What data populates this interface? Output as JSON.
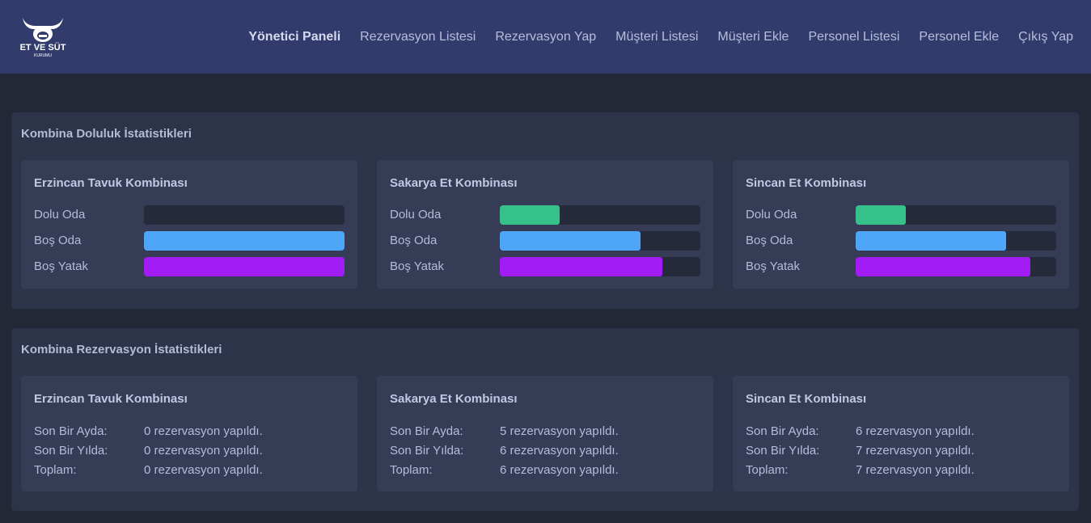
{
  "logo": {
    "text": "ET VE SÜT",
    "subtext": "KURUMU"
  },
  "nav": {
    "items": [
      {
        "label": "Yönetici Paneli",
        "active": true
      },
      {
        "label": "Rezervasyon Listesi",
        "active": false
      },
      {
        "label": "Rezervasyon Yap",
        "active": false
      },
      {
        "label": "Müşteri Listesi",
        "active": false
      },
      {
        "label": "Müşteri Ekle",
        "active": false
      },
      {
        "label": "Personel Listesi",
        "active": false
      },
      {
        "label": "Personel Ekle",
        "active": false
      },
      {
        "label": "Çıkış Yap",
        "active": false
      }
    ]
  },
  "colors": {
    "dolu_oda": "#36c08a",
    "bos_oda": "#4fa6f8",
    "bos_yatak": "#a11cf5"
  },
  "occupancy": {
    "title": "Kombina Doluluk İstatistikleri",
    "labels": {
      "dolu_oda": "Dolu Oda",
      "bos_oda": "Boş Oda",
      "bos_yatak": "Boş Yatak"
    },
    "cards": [
      {
        "name": "Erzincan Tavuk Kombinası",
        "dolu_oda": 0.0,
        "bos_oda": 1.0,
        "bos_yatak": 1.0
      },
      {
        "name": "Sakarya Et Kombinası",
        "dolu_oda": 0.3,
        "bos_oda": 0.7,
        "bos_yatak": 0.81
      },
      {
        "name": "Sincan Et Kombinası",
        "dolu_oda": 0.25,
        "bos_oda": 0.75,
        "bos_yatak": 0.87
      }
    ]
  },
  "reservations": {
    "title": "Kombina Rezervasyon İstatistikleri",
    "labels": {
      "month": "Son Bir Ayda:",
      "year": "Son Bir Yılda:",
      "total": "Toplam:"
    },
    "cards": [
      {
        "name": "Erzincan Tavuk Kombinası",
        "month": "0 rezervasyon yapıldı.",
        "year": "0 rezervasyon yapıldı.",
        "total": "0 rezervasyon yapıldı."
      },
      {
        "name": "Sakarya Et Kombinası",
        "month": "5 rezervasyon yapıldı.",
        "year": "6 rezervasyon yapıldı.",
        "total": "6 rezervasyon yapıldı."
      },
      {
        "name": "Sincan Et Kombinası",
        "month": "6 rezervasyon yapıldı.",
        "year": "7 rezervasyon yapıldı.",
        "total": "7 rezervasyon yapıldı."
      }
    ]
  }
}
